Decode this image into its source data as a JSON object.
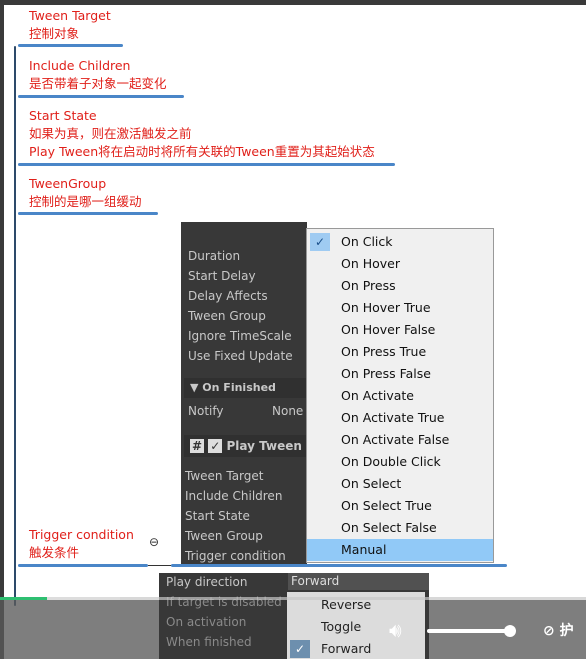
{
  "notes": [
    {
      "title": "Tween Target",
      "desc": [
        "控制对象"
      ]
    },
    {
      "title": "Include Children",
      "desc": [
        "是否带着子对象一起变化"
      ]
    },
    {
      "title": "Start State",
      "desc": [
        "如果为真，则在激活触发之前",
        "Play Tween将在启动时将所有关联的Tween重置为其起始状态"
      ]
    },
    {
      "title": "TweenGroup",
      "desc": [
        "控制的是哪一组缓动"
      ]
    },
    {
      "title": "Trigger condition",
      "desc": [
        "触发条件"
      ]
    }
  ],
  "tween_props": [
    "Duration",
    "Start Delay",
    "Delay Affects",
    "Tween Group",
    "Ignore TimeScale",
    "Use Fixed Update"
  ],
  "on_finished": {
    "label": "On Finished",
    "notify": "Notify",
    "notify_value": "None"
  },
  "play_tween": {
    "title": "Play Tween",
    "props": [
      "Tween Target",
      "Include Children",
      "Start State",
      "Tween Group",
      "Trigger condition"
    ]
  },
  "trigger_options": [
    "On Click",
    "On Hover",
    "On Press",
    "On Hover True",
    "On Hover False",
    "On Press True",
    "On Press False",
    "On Activate",
    "On Activate True",
    "On Activate False",
    "On Double Click",
    "On Select",
    "On Select True",
    "On Select False",
    "Manual"
  ],
  "trigger_checked": "On Click",
  "trigger_highlighted": "Manual",
  "play_direction": {
    "label": "Play direction",
    "value": "Forward",
    "rows": [
      "If target is disabled",
      "On activation",
      "When finished"
    ],
    "options": [
      "Reverse",
      "Toggle",
      "Forward"
    ],
    "checked": "Forward"
  },
  "video": {
    "progress_percent": 8,
    "volume_percent": 92,
    "eye_label": "护"
  },
  "colors": {
    "note": "#e0201a",
    "line": "#4a86c8",
    "highlight": "#91c9f7"
  }
}
